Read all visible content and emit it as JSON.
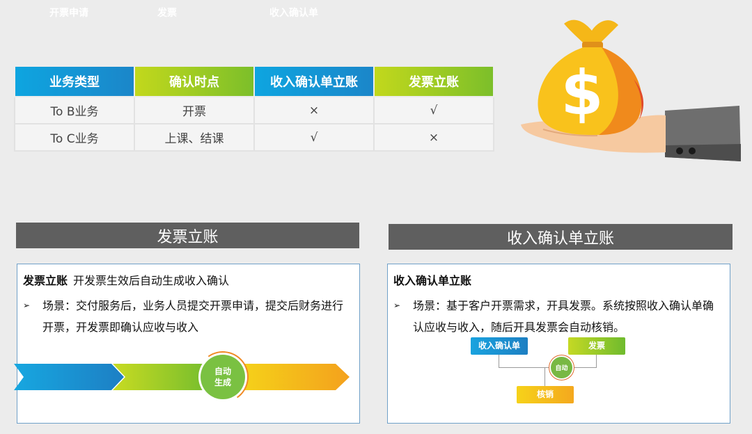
{
  "table": {
    "headers": [
      "业务类型",
      "确认时点",
      "收入确认单立账",
      "发票立账"
    ],
    "rows": [
      [
        "To B业务",
        "开票",
        "×",
        "√"
      ],
      [
        "To C业务",
        "上课、结课",
        "√",
        "×"
      ]
    ]
  },
  "illustration": {
    "symbol": "$"
  },
  "left_panel": {
    "header": "发票立账",
    "title_bold": "发票立账",
    "title_rest": "开发票生效后自动生成收入确认",
    "bullet_marker": "➢",
    "bullet": "场景：交付服务后，业务人员提交开票申请，提交后财务进行开票，开发票即确认应收与收入",
    "flow": {
      "step1": "开票申请",
      "step2": "发票",
      "circle_line1": "自动",
      "circle_line2": "生成",
      "step3": "收入确认单"
    }
  },
  "right_panel": {
    "header": "收入确认单立账",
    "title_bold": "收入确认单立账",
    "bullet_marker": "➢",
    "bullet": "场景：基于客户开票需求，开具发票。系统按照收入确认单确认应收与收入，随后开具发票会自动核销。",
    "diagram": {
      "box1": "收入确认单",
      "box2": "发票",
      "circle": "自动",
      "box3": "核销"
    }
  },
  "colors": {
    "blue": "#1b8fd2",
    "green": "#8cc63f",
    "yellow": "#f4b41e",
    "bar_gray": "#5f5f5f"
  }
}
